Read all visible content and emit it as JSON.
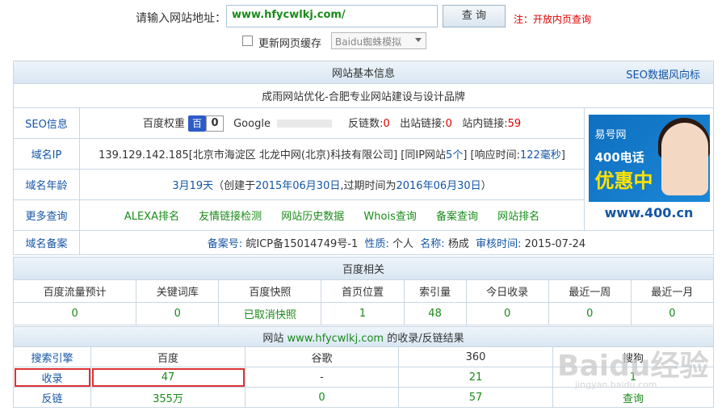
{
  "search": {
    "label": "请输入网站地址：",
    "value": "www.hfycwlkj.com/",
    "button": "查 询",
    "note": "注：开放内页查询",
    "cache_label": "更新网页缓存",
    "spider_selected": "Baidu蜘蛛模拟"
  },
  "basic": {
    "header": "网站基本信息",
    "header_link": "SEO数据风向标",
    "site_title": "成雨网站优化-合肥专业网站建设与设计品牌",
    "seo_label": "SEO信息",
    "baidu_weight_label": "百度权重",
    "baidu_weight_icon": "百",
    "baidu_weight": "0",
    "google_label": "Google",
    "backlinks_label": "反链数:",
    "backlinks": "0",
    "outlinks_label": "出站链接:",
    "outlinks": "0",
    "inlinks_label": "站内链接:",
    "inlinks": "59",
    "ip_label": "域名IP",
    "ip_text": "139.129.142.185[北京市海淀区 北龙中网(北京)科技有限公司]",
    "same_ip_prefix": "[同IP网站",
    "same_ip_count": "5个",
    "same_ip_suffix": "]",
    "resp_prefix": "[响应时间:",
    "resp_value": "122毫秒",
    "resp_suffix": "]",
    "age_label": "域名年龄",
    "age_value": "3月19天",
    "created_prefix": "（创建于",
    "created": "2015年06月30日",
    "expire_prefix": ",过期时间为",
    "expire": "2016年06月30日",
    "age_suffix": "）",
    "more_label": "更多查询",
    "more_links": [
      "ALEXA排名",
      "友情链接检测",
      "网站历史数据",
      "Whois查询",
      "备案查询",
      "网站排名"
    ],
    "icp_label": "域名备案",
    "icp_no_label": "备案号:",
    "icp_no": "皖ICP备15014749号-1",
    "nature_label": "性质:",
    "nature": "个人",
    "name_label": "名称:",
    "name": "杨成",
    "audit_label": "审核时间:",
    "audit": "2015-07-24"
  },
  "ad": {
    "brand": "易号网",
    "line1": "400电话",
    "line2": "优惠中",
    "url": "www.400.cn"
  },
  "baidu": {
    "header": "百度相关",
    "columns": [
      "百度流量预计",
      "关键词库",
      "百度快照",
      "首页位置",
      "索引量",
      "今日收录",
      "最近一周",
      "最近一月"
    ],
    "values": [
      "0",
      "0",
      "已取消快照",
      "1",
      "48",
      "0",
      "0",
      "0"
    ]
  },
  "results": {
    "header_prefix": "网站",
    "header_site": "www.hfycwlkj.com",
    "header_suffix": "的收录/反链结果",
    "columns": [
      "搜索引擎",
      "百度",
      "谷歌",
      "360",
      "搜狗"
    ],
    "rows": [
      {
        "label": "收录",
        "values": [
          "47",
          "-",
          "21",
          "1"
        ]
      },
      {
        "label": "反链",
        "values": [
          "355万",
          "0",
          "57",
          "查询"
        ]
      }
    ]
  },
  "watermark": {
    "main": "Baidu经验",
    "sub": "jingyan.baidu.com"
  },
  "colors": {
    "link": "#1455a6",
    "green": "#1a8a1a",
    "red": "#dd0000",
    "header_bg": "#d8e6f2"
  }
}
